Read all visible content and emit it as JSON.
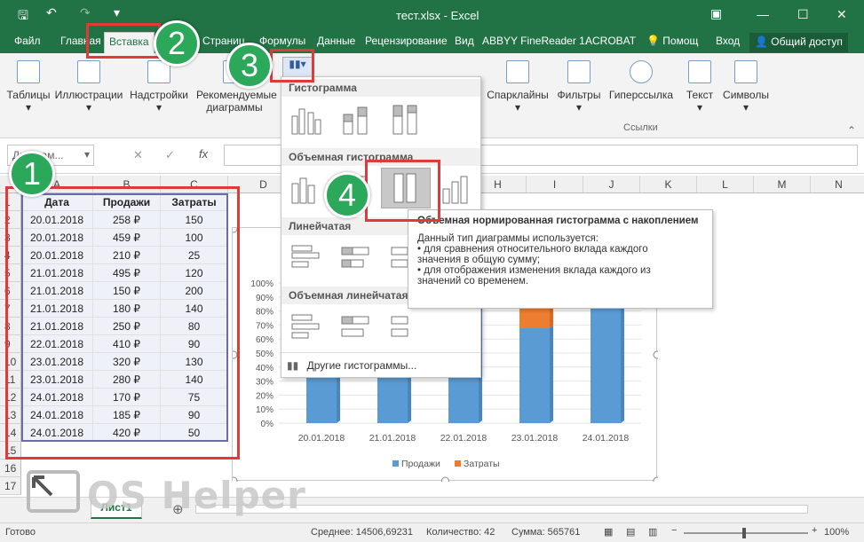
{
  "window": {
    "title": "тест.xlsx - Excel",
    "minimize": "—",
    "maximize": "☐",
    "close": "✕",
    "restore_icon": "▣"
  },
  "tabs": [
    "Файл",
    "Главная",
    "Вставка",
    "Страниц",
    "Формулы",
    "Данные",
    "Рецензирование",
    "Вид",
    "ABBYY FineReader 1.",
    "ACROBAT",
    "Помощ",
    "Вход",
    "Общий доступ"
  ],
  "ribbon": {
    "groups": [
      "Таблицы",
      "Иллюстрации",
      "Надстройки",
      "Рекомендуемые диаграммы",
      "Спарклайны",
      "Фильтры",
      "Гиперссылка",
      "Текст",
      "Символы"
    ],
    "links_label": "Ссылки"
  },
  "formula": {
    "namebox": "Диаграм...",
    "fx": "fx",
    "cancel": "✕",
    "enter": "✓"
  },
  "columns": [
    "A",
    "B",
    "C",
    "D",
    "E",
    "F",
    "G",
    "H",
    "I",
    "J",
    "K",
    "L",
    "M",
    "N"
  ],
  "rows": [
    "1",
    "2",
    "3",
    "4",
    "5",
    "6",
    "7",
    "8",
    "9",
    "10",
    "11",
    "12",
    "13",
    "14",
    "15",
    "16",
    "17"
  ],
  "table": {
    "headers": [
      "Дата",
      "Продажи",
      "Затраты"
    ],
    "rows": [
      [
        "20.01.2018",
        "258 ₽",
        "150"
      ],
      [
        "20.01.2018",
        "459 ₽",
        "100"
      ],
      [
        "20.01.2018",
        "210 ₽",
        "25"
      ],
      [
        "21.01.2018",
        "495 ₽",
        "120"
      ],
      [
        "21.01.2018",
        "150 ₽",
        "200"
      ],
      [
        "21.01.2018",
        "180 ₽",
        "140"
      ],
      [
        "21.01.2018",
        "250 ₽",
        "80"
      ],
      [
        "22.01.2018",
        "410 ₽",
        "90"
      ],
      [
        "23.01.2018",
        "320 ₽",
        "130"
      ],
      [
        "23.01.2018",
        "280 ₽",
        "140"
      ],
      [
        "24.01.2018",
        "170 ₽",
        "75"
      ],
      [
        "24.01.2018",
        "185 ₽",
        "90"
      ],
      [
        "24.01.2018",
        "420 ₽",
        "50"
      ]
    ]
  },
  "chart_data": {
    "type": "bar",
    "stacked": "percent",
    "categories": [
      "20.01.2018",
      "21.01.2018",
      "22.01.2018",
      "23.01.2018",
      "24.01.2018"
    ],
    "series": [
      {
        "name": "Продажи",
        "color": "#5b9bd5",
        "values": [
          0.89,
          0.88,
          0.82,
          0.68,
          0.82
        ]
      },
      {
        "name": "Затраты",
        "color": "#ed7d31",
        "values": [
          0.11,
          0.12,
          0.18,
          0.32,
          0.18
        ]
      }
    ],
    "yticks": [
      "0%",
      "10%",
      "20%",
      "30%",
      "40%",
      "50%",
      "60%",
      "70%",
      "80%",
      "90%",
      "100%"
    ],
    "ylim": [
      0,
      1
    ]
  },
  "dropdown": {
    "sec1": "Гистограмма",
    "sec2": "Объемная гистограмма",
    "sec3": "Линейчатая",
    "sec4": "Объемная линейчатая",
    "more": "Другие гистограммы..."
  },
  "tooltip": {
    "title": "Объемная нормированная гистограмма с накоплением",
    "line1": "Данный тип диаграммы используется:",
    "line2": "• для сравнения относительного вклада каждого",
    "line3": "значения в общую сумму;",
    "line4": "• для отображения изменения вклада каждого из",
    "line5": "значений со временем."
  },
  "badges": [
    "1",
    "2",
    "3",
    "4"
  ],
  "sheet": {
    "name": "Лист1",
    "add": "⊕"
  },
  "status": {
    "ready": "Готово",
    "avg": "Среднее: 14506,69231",
    "count": "Количество: 42",
    "sum": "Сумма: 565761",
    "zoom": "100%",
    "minus": "−",
    "plus": "+"
  },
  "watermark": "OS Helper"
}
